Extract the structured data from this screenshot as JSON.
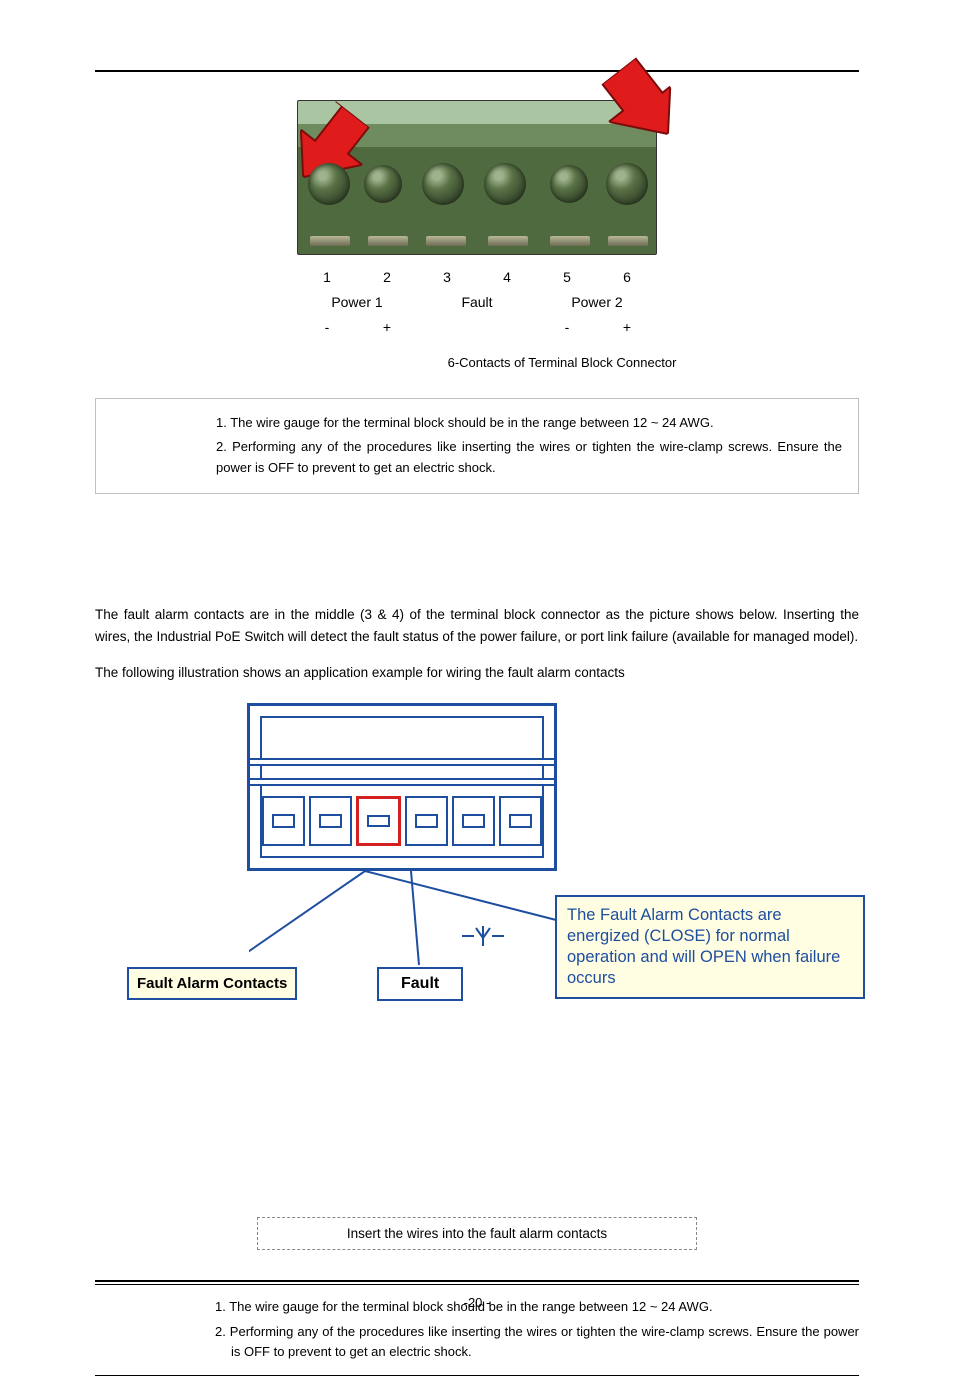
{
  "figure1": {
    "numbers": [
      "1",
      "2",
      "3",
      "4",
      "5",
      "6"
    ],
    "group_labels": [
      "Power 1",
      "Fault",
      "Power 2"
    ],
    "polarity_row": [
      "-",
      "+",
      "",
      "",
      "-",
      "+"
    ],
    "caption": "6-Contacts of Terminal Block Connector"
  },
  "notebox": {
    "line1": "1. The wire gauge for the terminal block should be in the range between 12 ~ 24 AWG.",
    "line2": "2. Performing any of the procedures like inserting the wires or tighten the wire-clamp screws. Ensure the power is OFF to prevent to get an electric shock."
  },
  "para1": "The fault alarm contacts are in the middle (3 & 4) of the terminal block connector as the picture shows below. Inserting the wires, the Industrial PoE Switch will detect the fault status of the power failure, or port link failure (available for managed model).",
  "para2": "The following illustration shows an application example for wiring the fault alarm contacts",
  "figure2": {
    "fault_contacts_label": "Fault Alarm Contacts",
    "fault_label": "Fault",
    "explain": "The Fault Alarm Contacts are energized (CLOSE) for normal operation and will OPEN when failure occurs",
    "diode": "—↓—",
    "instruction": "Insert the wires into the fault alarm contacts"
  },
  "bottom_notes": {
    "line1": "1. The wire gauge for the terminal block should be in the range between 12 ~ 24 AWG.",
    "line2": "2. Performing any of the procedures like inserting the wires or tighten the wire-clamp screws. Ensure the power is OFF to prevent to get an electric shock."
  },
  "page_number": "-20 -"
}
